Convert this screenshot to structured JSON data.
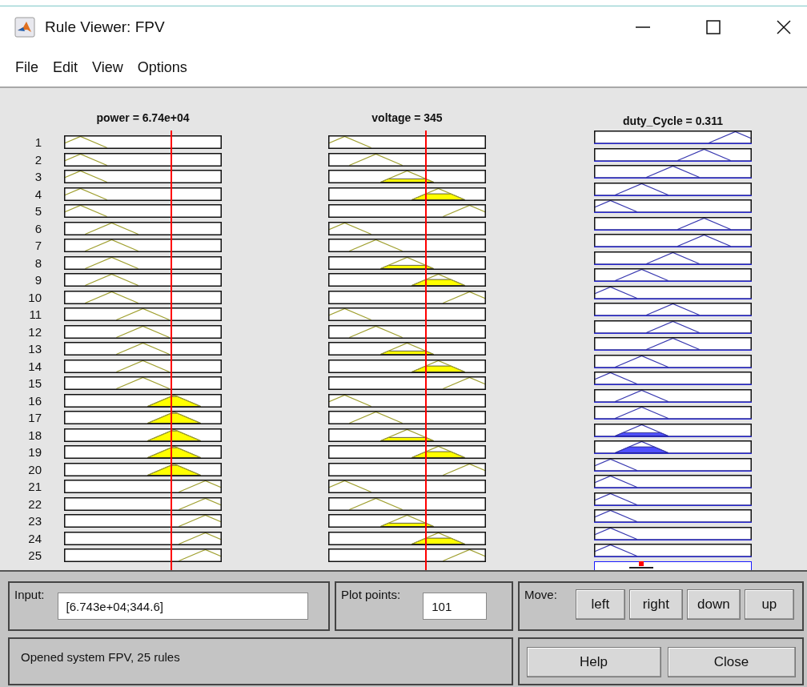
{
  "window": {
    "title": "Rule Viewer: FPV"
  },
  "menu": [
    "File",
    "Edit",
    "View",
    "Options"
  ],
  "variables": [
    {
      "label": "power = 6.74e+04",
      "kind": "input",
      "level": 0.68
    },
    {
      "label": "voltage = 345",
      "kind": "input",
      "level": 0.62
    },
    {
      "label": "duty_Cycle = 0.311",
      "kind": "output",
      "level": 0.3
    }
  ],
  "rules": [
    {
      "number": "1",
      "cells": [
        {
          "kind": "lowest"
        },
        {
          "kind": "lowest"
        },
        {
          "kind": "highest"
        }
      ]
    },
    {
      "number": "2",
      "cells": [
        {
          "kind": "lowest"
        },
        {
          "kind": "low"
        },
        {
          "kind": "high"
        }
      ]
    },
    {
      "number": "3",
      "cells": [
        {
          "kind": "lowest"
        },
        {
          "kind": "middle"
        },
        {
          "kind": "middle"
        }
      ]
    },
    {
      "number": "4",
      "cells": [
        {
          "kind": "lowest"
        },
        {
          "kind": "high"
        },
        {
          "kind": "low"
        }
      ]
    },
    {
      "number": "5",
      "cells": [
        {
          "kind": "lowest"
        },
        {
          "kind": "highest"
        },
        {
          "kind": "lowest"
        }
      ]
    },
    {
      "number": "6",
      "cells": [
        {
          "kind": "low"
        },
        {
          "kind": "lowest"
        },
        {
          "kind": "high"
        }
      ]
    },
    {
      "number": "7",
      "cells": [
        {
          "kind": "low"
        },
        {
          "kind": "low"
        },
        {
          "kind": "high"
        }
      ]
    },
    {
      "number": "8",
      "cells": [
        {
          "kind": "low"
        },
        {
          "kind": "middle"
        },
        {
          "kind": "middle"
        }
      ]
    },
    {
      "number": "9",
      "cells": [
        {
          "kind": "low"
        },
        {
          "kind": "high"
        },
        {
          "kind": "low"
        }
      ]
    },
    {
      "number": "10",
      "cells": [
        {
          "kind": "low"
        },
        {
          "kind": "highest"
        },
        {
          "kind": "lowest"
        }
      ]
    },
    {
      "number": "11",
      "cells": [
        {
          "kind": "middle"
        },
        {
          "kind": "lowest"
        },
        {
          "kind": "middle"
        }
      ]
    },
    {
      "number": "12",
      "cells": [
        {
          "kind": "middle"
        },
        {
          "kind": "low"
        },
        {
          "kind": "middle"
        }
      ]
    },
    {
      "number": "13",
      "cells": [
        {
          "kind": "middle"
        },
        {
          "kind": "middle"
        },
        {
          "kind": "middle"
        }
      ]
    },
    {
      "number": "14",
      "cells": [
        {
          "kind": "middle"
        },
        {
          "kind": "high"
        },
        {
          "kind": "low"
        }
      ]
    },
    {
      "number": "15",
      "cells": [
        {
          "kind": "middle"
        },
        {
          "kind": "highest"
        },
        {
          "kind": "lowest"
        }
      ]
    },
    {
      "number": "16",
      "cells": [
        {
          "kind": "high"
        },
        {
          "kind": "lowest"
        },
        {
          "kind": "low"
        }
      ]
    },
    {
      "number": "17",
      "cells": [
        {
          "kind": "high"
        },
        {
          "kind": "low"
        },
        {
          "kind": "low"
        }
      ]
    },
    {
      "number": "18",
      "cells": [
        {
          "kind": "high"
        },
        {
          "kind": "middle"
        },
        {
          "kind": "low"
        }
      ]
    },
    {
      "number": "19",
      "cells": [
        {
          "kind": "high"
        },
        {
          "kind": "high"
        },
        {
          "kind": "low"
        }
      ]
    },
    {
      "number": "20",
      "cells": [
        {
          "kind": "high"
        },
        {
          "kind": "highest"
        },
        {
          "kind": "lowest"
        }
      ]
    },
    {
      "number": "21",
      "cells": [
        {
          "kind": "highest"
        },
        {
          "kind": "lowest"
        },
        {
          "kind": "lowest"
        }
      ]
    },
    {
      "number": "22",
      "cells": [
        {
          "kind": "highest"
        },
        {
          "kind": "low"
        },
        {
          "kind": "lowest"
        }
      ]
    },
    {
      "number": "23",
      "cells": [
        {
          "kind": "highest"
        },
        {
          "kind": "middle"
        },
        {
          "kind": "lowest"
        }
      ]
    },
    {
      "number": "24",
      "cells": [
        {
          "kind": "highest"
        },
        {
          "kind": "high"
        },
        {
          "kind": "lowest"
        }
      ]
    },
    {
      "number": "25",
      "cells": [
        {
          "kind": "highest"
        },
        {
          "kind": "highest"
        },
        {
          "kind": "lowest"
        }
      ]
    }
  ],
  "input": {
    "label": "Input:",
    "value": "[6.743e+04;344.6]"
  },
  "plot_points": {
    "label": "Plot points:",
    "value": "101"
  },
  "move": {
    "label": "Move:",
    "buttons": [
      "left",
      "right",
      "down",
      "up"
    ]
  },
  "status": "Opened system FPV, 25 rules",
  "buttons": [
    "Help",
    "Close"
  ]
}
